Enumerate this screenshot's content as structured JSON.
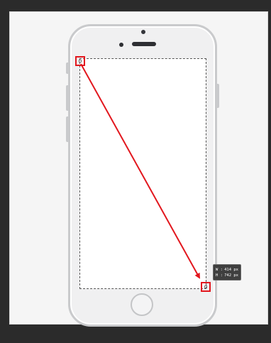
{
  "tooltip": {
    "width_label": "W :",
    "width_value": "414 px",
    "height_label": "H :",
    "height_value": "742 px"
  },
  "colors": {
    "app_background": "#2b2b2b",
    "canvas": "#f5f5f5",
    "phone_frame": "#c9cacc",
    "annotation_red": "#e2171e",
    "tooltip_bg": "#3f3f3f"
  },
  "icons": {
    "phone": "iphone-mockup-icon",
    "arrow": "diagonal-arrow-icon"
  }
}
